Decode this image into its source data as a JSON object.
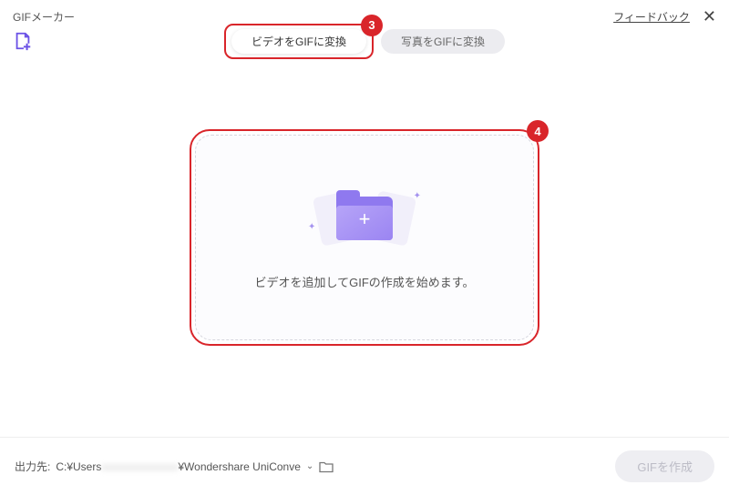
{
  "header": {
    "title": "GIFメーカー",
    "feedback": "フィードバック"
  },
  "tabs": {
    "video": "ビデオをGIFに変換",
    "photo": "写真をGIFに変換"
  },
  "annotations": {
    "step3": "3",
    "step4": "4"
  },
  "dropzone": {
    "text": "ビデオを追加してGIFの作成を始めます。"
  },
  "footer": {
    "out_label": "出力先:",
    "path_prefix": "C:¥Users",
    "path_suffix": "¥Wondershare UniConve",
    "create_button": "GIFを作成"
  }
}
